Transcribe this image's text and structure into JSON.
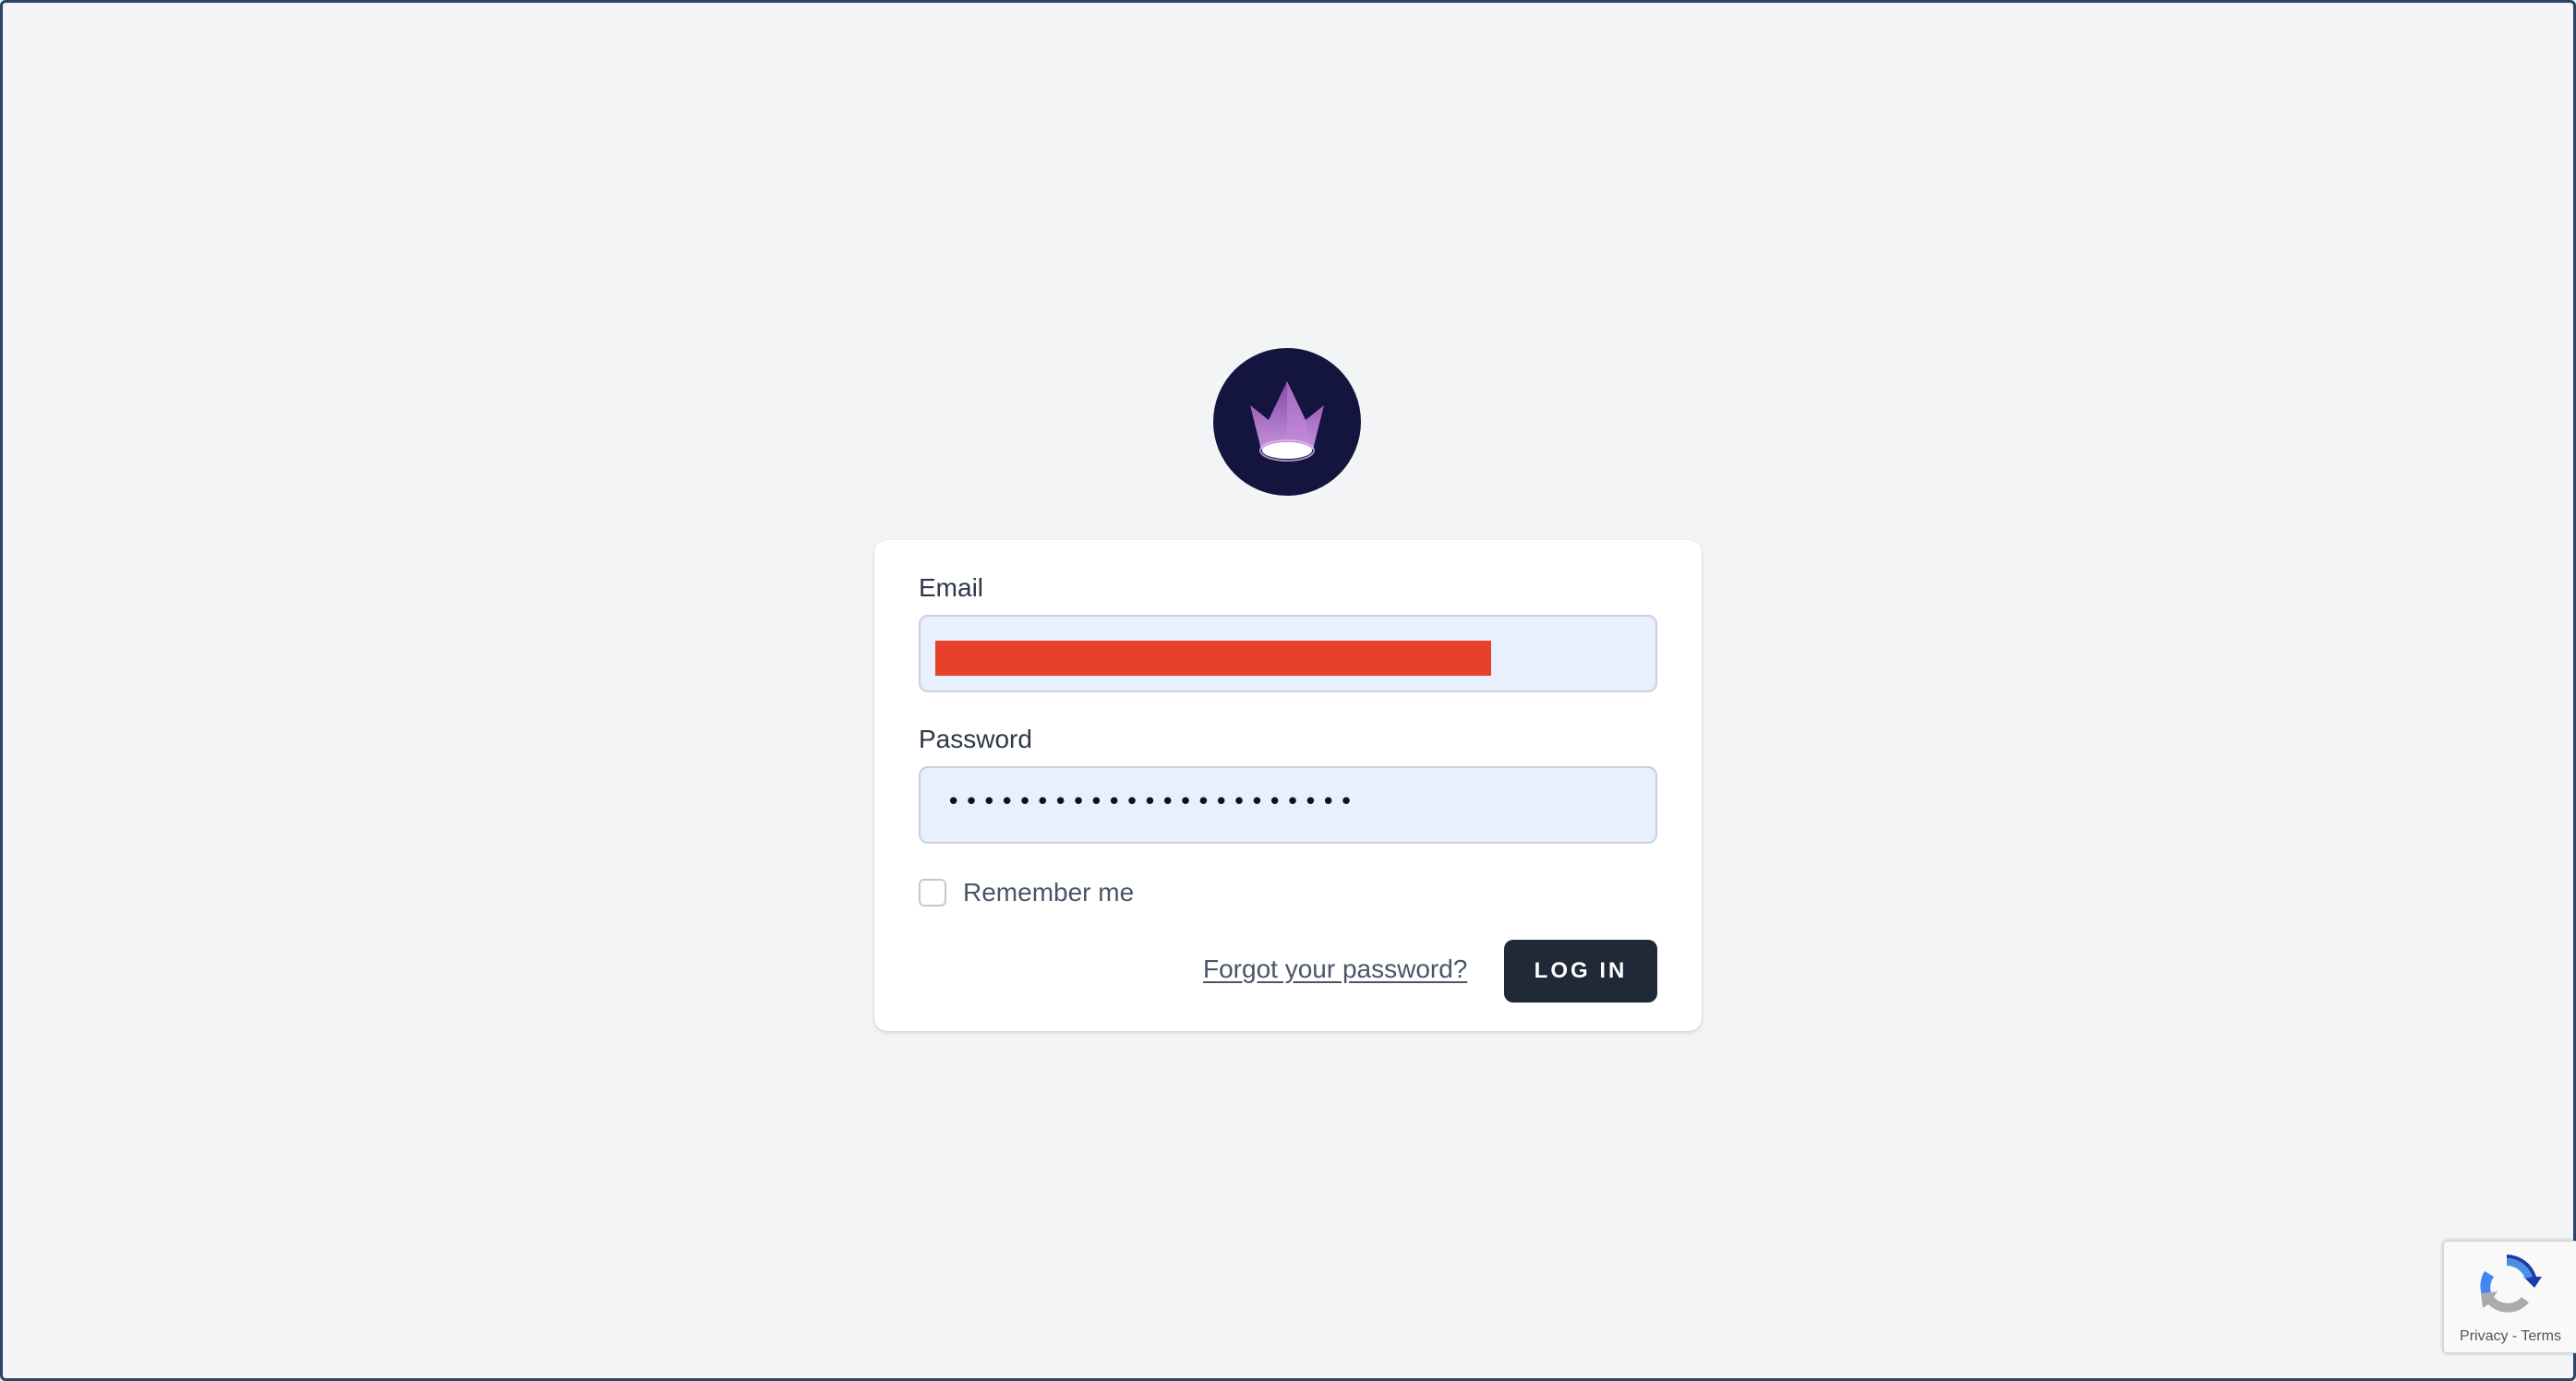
{
  "brand": {
    "logo_icon": "crown-spotlight-icon",
    "logo_bg": "#13153f",
    "logo_accent": "#b067c8"
  },
  "login_form": {
    "email_label": "Email",
    "email_value_redacted": true,
    "redaction_color": "#e8412a",
    "password_label": "Password",
    "password_value": "•••••••••••••••••••••••",
    "remember_label": "Remember me",
    "remember_checked": false,
    "forgot_link": "Forgot your password?",
    "login_button": "LOG IN"
  },
  "recaptcha": {
    "icon": "recaptcha-icon",
    "privacy": "Privacy",
    "separator": "-",
    "terms": "Terms"
  },
  "colors": {
    "background": "#f3f4f6",
    "input_autofill": "#e8f0fe",
    "button": "#1f2937"
  }
}
